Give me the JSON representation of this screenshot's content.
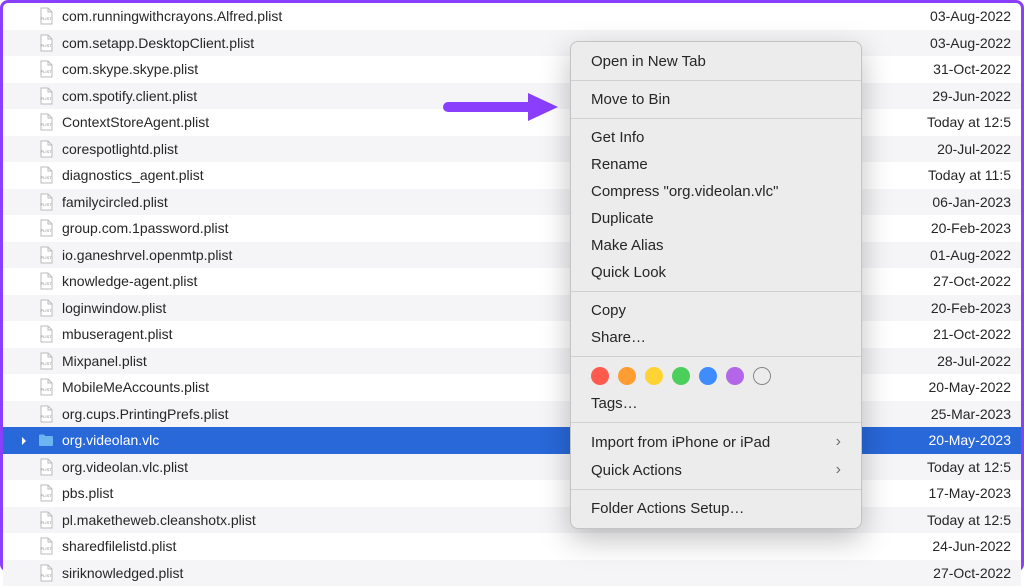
{
  "files": [
    {
      "name": "com.runningwithcrayons.Alfred.plist",
      "date": "03-Aug-2022",
      "alt": false,
      "type": "file"
    },
    {
      "name": "com.setapp.DesktopClient.plist",
      "date": "03-Aug-2022",
      "alt": true,
      "type": "file"
    },
    {
      "name": "com.skype.skype.plist",
      "date": "31-Oct-2022",
      "alt": false,
      "type": "file"
    },
    {
      "name": "com.spotify.client.plist",
      "date": "29-Jun-2022",
      "alt": true,
      "type": "file"
    },
    {
      "name": "ContextStoreAgent.plist",
      "date": "Today at 12:5",
      "alt": false,
      "type": "file"
    },
    {
      "name": "corespotlightd.plist",
      "date": "20-Jul-2022",
      "alt": true,
      "type": "file"
    },
    {
      "name": "diagnostics_agent.plist",
      "date": "Today at 11:5",
      "alt": false,
      "type": "file"
    },
    {
      "name": "familycircled.plist",
      "date": "06-Jan-2023",
      "alt": true,
      "type": "file"
    },
    {
      "name": "group.com.1password.plist",
      "date": "20-Feb-2023",
      "alt": false,
      "type": "file"
    },
    {
      "name": "io.ganeshrvel.openmtp.plist",
      "date": "01-Aug-2022",
      "alt": true,
      "type": "file"
    },
    {
      "name": "knowledge-agent.plist",
      "date": "27-Oct-2022",
      "alt": false,
      "type": "file"
    },
    {
      "name": "loginwindow.plist",
      "date": "20-Feb-2023",
      "alt": true,
      "type": "file"
    },
    {
      "name": "mbuseragent.plist",
      "date": "21-Oct-2022",
      "alt": false,
      "type": "file"
    },
    {
      "name": "Mixpanel.plist",
      "date": "28-Jul-2022",
      "alt": true,
      "type": "file"
    },
    {
      "name": "MobileMeAccounts.plist",
      "date": "20-May-2022",
      "alt": false,
      "type": "file"
    },
    {
      "name": "org.cups.PrintingPrefs.plist",
      "date": "25-Mar-2023",
      "alt": true,
      "type": "file"
    },
    {
      "name": "org.videolan.vlc",
      "date": "20-May-2023",
      "alt": false,
      "type": "folder",
      "selected": true
    },
    {
      "name": "org.videolan.vlc.plist",
      "date": "Today at 12:5",
      "alt": true,
      "type": "file"
    },
    {
      "name": "pbs.plist",
      "date": "17-May-2023",
      "alt": false,
      "type": "file"
    },
    {
      "name": "pl.maketheweb.cleanshotx.plist",
      "date": "Today at 12:5",
      "alt": true,
      "type": "file"
    },
    {
      "name": "sharedfilelistd.plist",
      "date": "24-Jun-2022",
      "alt": false,
      "type": "file"
    },
    {
      "name": "siriknowledged.plist",
      "date": "27-Oct-2022",
      "alt": true,
      "type": "file"
    }
  ],
  "contextMenu": {
    "openInNewTab": "Open in New Tab",
    "moveToBin": "Move to Bin",
    "getInfo": "Get Info",
    "rename": "Rename",
    "compress": "Compress \"org.videolan.vlc\"",
    "duplicate": "Duplicate",
    "makeAlias": "Make Alias",
    "quickLook": "Quick Look",
    "copy": "Copy",
    "share": "Share…",
    "tags": "Tags…",
    "importFromDevice": "Import from iPhone or iPad",
    "quickActions": "Quick Actions",
    "folderActions": "Folder Actions Setup…"
  },
  "tagColors": {
    "red": "#ff5b4c",
    "orange": "#ff9d33",
    "yellow": "#ffd333",
    "green": "#4bce5b",
    "blue": "#3f8cff",
    "purple": "#b366e8"
  }
}
